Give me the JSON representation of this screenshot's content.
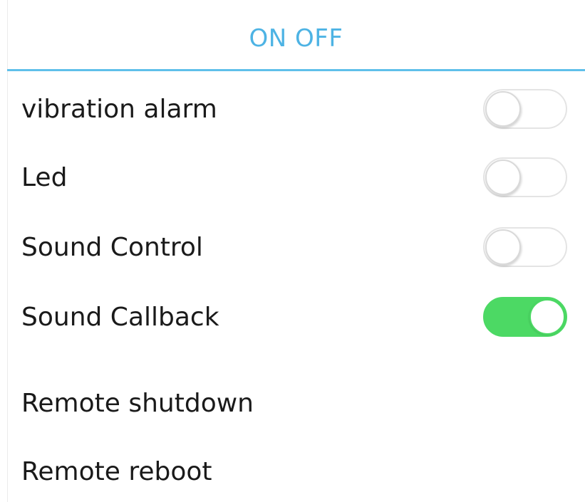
{
  "header": {
    "title": "ON OFF"
  },
  "settings": {
    "items": [
      {
        "label": "vibration alarm",
        "state": "off"
      },
      {
        "label": "Led",
        "state": "off"
      },
      {
        "label": "Sound Control",
        "state": "off"
      },
      {
        "label": "Sound Callback",
        "state": "on"
      }
    ]
  },
  "actions": {
    "items": [
      {
        "label": "Remote shutdown"
      },
      {
        "label": "Remote reboot"
      }
    ]
  },
  "colors": {
    "accent": "#4db3e4",
    "toggle_on": "#4cd964",
    "toggle_off_border": "#e4e4e4"
  }
}
